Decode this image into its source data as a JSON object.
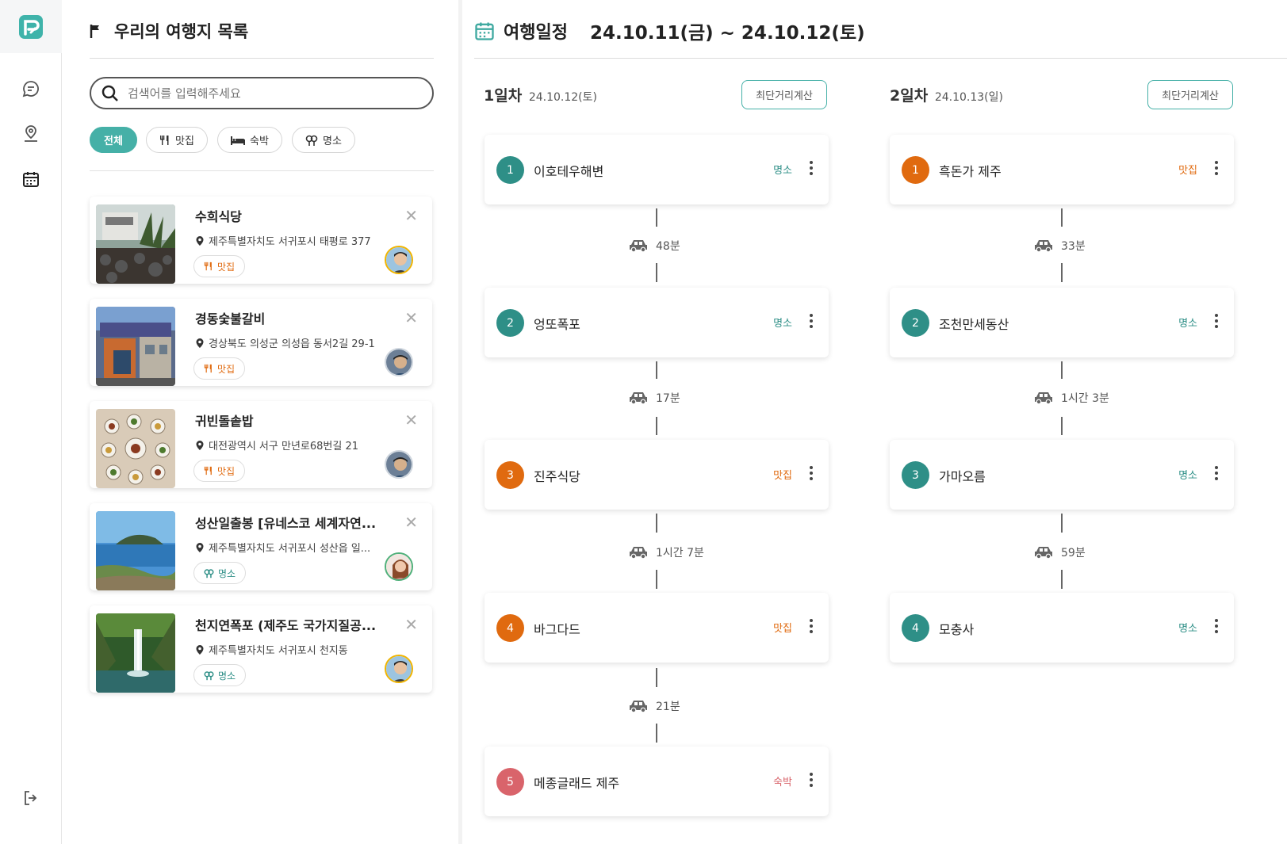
{
  "colors": {
    "accent": "#45b0a7",
    "restaurant": "#e06a0f",
    "attraction": "#2e8f87",
    "lodging": "#d9646b"
  },
  "sidebar": {
    "icons": [
      "logo-icon",
      "chat-icon",
      "user-location-icon",
      "calendar-icon",
      "logout-icon"
    ]
  },
  "left_panel": {
    "title": "우리의 여행지 목록",
    "search": {
      "placeholder": "검색어를 입력해주세요"
    },
    "filters": [
      {
        "label": "전체",
        "active": true
      },
      {
        "label": "맛집",
        "icon": "fork-knife-icon"
      },
      {
        "label": "숙박",
        "icon": "bed-icon"
      },
      {
        "label": "명소",
        "icon": "tree-icon"
      }
    ],
    "places": [
      {
        "name": "수희식당",
        "address": "제주특별자치도 서귀포시 태평로 377",
        "tag": "맛집"
      },
      {
        "name": "경동숯불갈비",
        "address": "경상북도 의성군 의성읍 동서2길 29-1",
        "tag": "맛집"
      },
      {
        "name": "귀빈돌솥밥",
        "address": "대전광역시 서구 만년로68번길 21",
        "tag": "맛집"
      },
      {
        "name": "성산일출봉 [유네스코 세계자연...",
        "address": "제주특별자치도 서귀포시 성산읍 일...",
        "tag": "명소"
      },
      {
        "name": "천지연폭포 (제주도 국가지질공...",
        "address": "제주특별자치도 서귀포시 천지동",
        "tag": "명소"
      }
    ]
  },
  "schedule": {
    "title": "여행일정",
    "dates": "24.10.11(금) ~ 24.10.12(토)",
    "route_button": "최단거리계산",
    "days": [
      {
        "label": "1일차",
        "date": "24.10.12(토)",
        "stops": [
          {
            "num": "1",
            "name": "이호테우해변",
            "cat": "명소"
          },
          {
            "num": "2",
            "name": "엉또폭포",
            "cat": "명소"
          },
          {
            "num": "3",
            "name": "진주식당",
            "cat": "맛집"
          },
          {
            "num": "4",
            "name": "바그다드",
            "cat": "맛집"
          },
          {
            "num": "5",
            "name": "메종글래드 제주",
            "cat": "숙박"
          }
        ],
        "travel": [
          "48분",
          "17분",
          "1시간 7분",
          "21분"
        ]
      },
      {
        "label": "2일차",
        "date": "24.10.13(일)",
        "stops": [
          {
            "num": "1",
            "name": "흑돈가 제주",
            "cat": "맛집"
          },
          {
            "num": "2",
            "name": "조천만세동산",
            "cat": "명소"
          },
          {
            "num": "3",
            "name": "가마오름",
            "cat": "명소"
          },
          {
            "num": "4",
            "name": "모충사",
            "cat": "명소"
          }
        ],
        "travel": [
          "33분",
          "1시간 3분",
          "59분"
        ]
      }
    ]
  }
}
